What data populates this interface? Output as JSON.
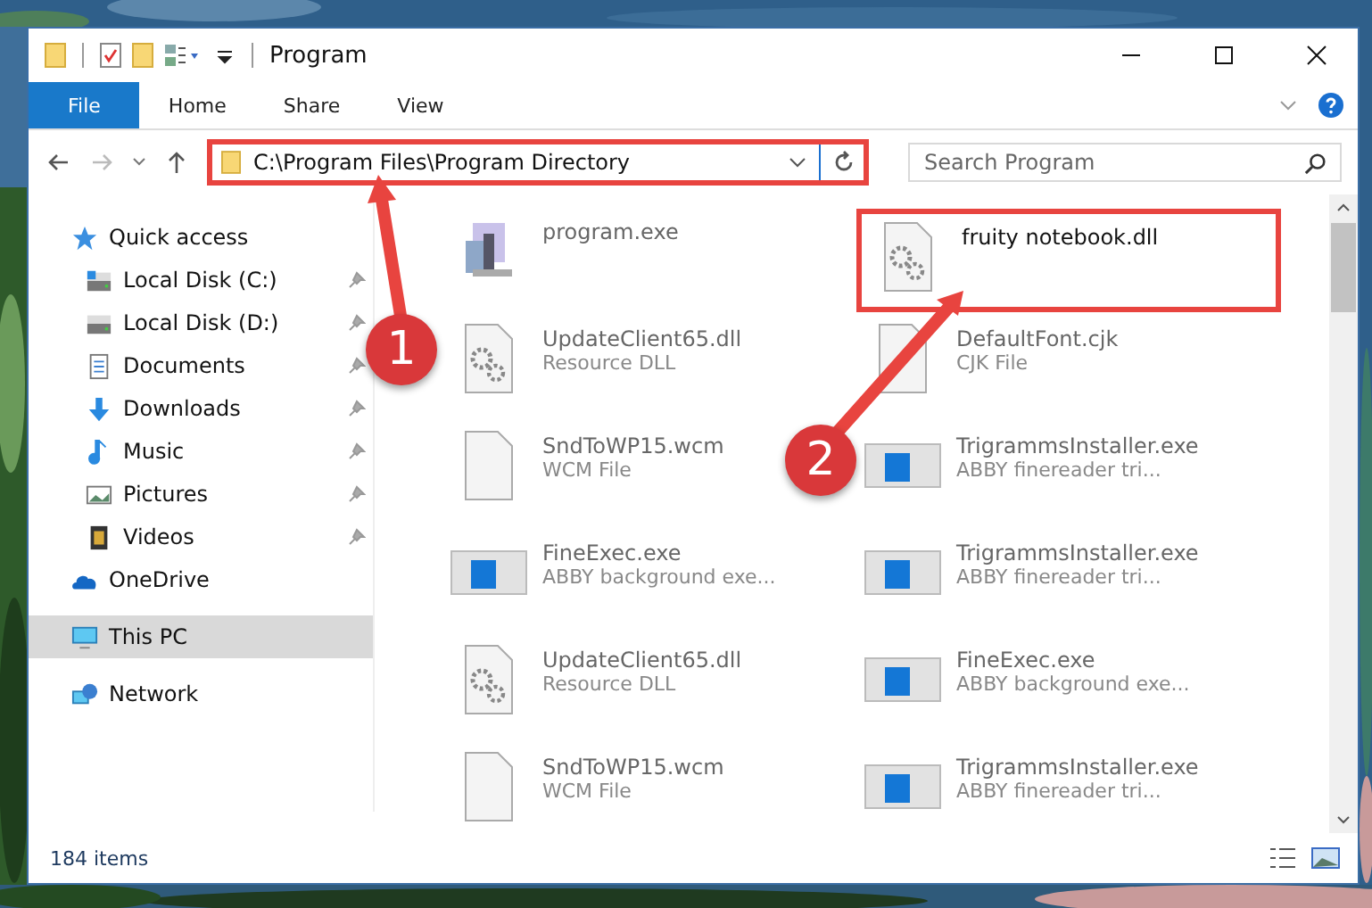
{
  "window": {
    "title": "Program"
  },
  "ribbon": {
    "tabs": [
      {
        "label": "File",
        "selected": true
      },
      {
        "label": "Home",
        "selected": false
      },
      {
        "label": "Share",
        "selected": false
      },
      {
        "label": "View",
        "selected": false
      }
    ]
  },
  "address": {
    "path": "C:\\Program Files\\Program Directory"
  },
  "search": {
    "placeholder": "Search Program"
  },
  "sidebar": {
    "items": [
      {
        "label": "Quick access",
        "kind": "star",
        "selected": false,
        "children": [
          {
            "label": "Local Disk (C:)",
            "kind": "system-drive",
            "pinned": true,
            "selected": false
          },
          {
            "label": "Local Disk (D:)",
            "kind": "drive",
            "pinned": true,
            "selected": false
          },
          {
            "label": "Documents",
            "kind": "documents",
            "pinned": true,
            "selected": false
          },
          {
            "label": "Downloads",
            "kind": "downloads",
            "pinned": true,
            "selected": false
          },
          {
            "label": "Music",
            "kind": "music",
            "pinned": true,
            "selected": false
          },
          {
            "label": "Pictures",
            "kind": "pictures",
            "pinned": true,
            "selected": false
          },
          {
            "label": "Videos",
            "kind": "videos",
            "pinned": true,
            "selected": false
          }
        ]
      },
      {
        "label": "OneDrive",
        "kind": "cloud",
        "selected": false
      },
      {
        "label": "This PC",
        "kind": "pc",
        "selected": true
      },
      {
        "label": "Network",
        "kind": "network",
        "selected": false
      }
    ]
  },
  "files": [
    {
      "name": "program.exe",
      "kind": "program"
    },
    {
      "name": "fruity notebook.dll",
      "kind": "dll",
      "highlighted": true
    },
    {
      "name": "UpdateClient65.dll",
      "type": "Resource DLL",
      "kind": "dll"
    },
    {
      "name": "DefaultFont.cjk",
      "type": "CJK File",
      "kind": "file"
    },
    {
      "name": "SndToWP15.wcm",
      "type": "WCM File",
      "kind": "file"
    },
    {
      "name": "TrigrammsInstaller.exe",
      "type": "ABBY finereader tri...",
      "kind": "app"
    },
    {
      "name": "FineExec.exe",
      "type": "ABBY background exe...",
      "kind": "app"
    },
    {
      "name": "TrigrammsInstaller.exe",
      "type": "ABBY finereader tri...",
      "kind": "app"
    },
    {
      "name": "UpdateClient65.dll",
      "type": "Resource DLL",
      "kind": "dll"
    },
    {
      "name": "FineExec.exe",
      "type": "ABBY background exe...",
      "kind": "app"
    },
    {
      "name": "SndToWP15.wcm",
      "type": "WCM File",
      "kind": "file"
    },
    {
      "name": "TrigrammsInstaller.exe",
      "type": "ABBY finereader tri...",
      "kind": "app"
    }
  ],
  "status_bar": {
    "count": "184 items"
  },
  "callouts": [
    {
      "number": "1"
    },
    {
      "number": "2"
    }
  ]
}
